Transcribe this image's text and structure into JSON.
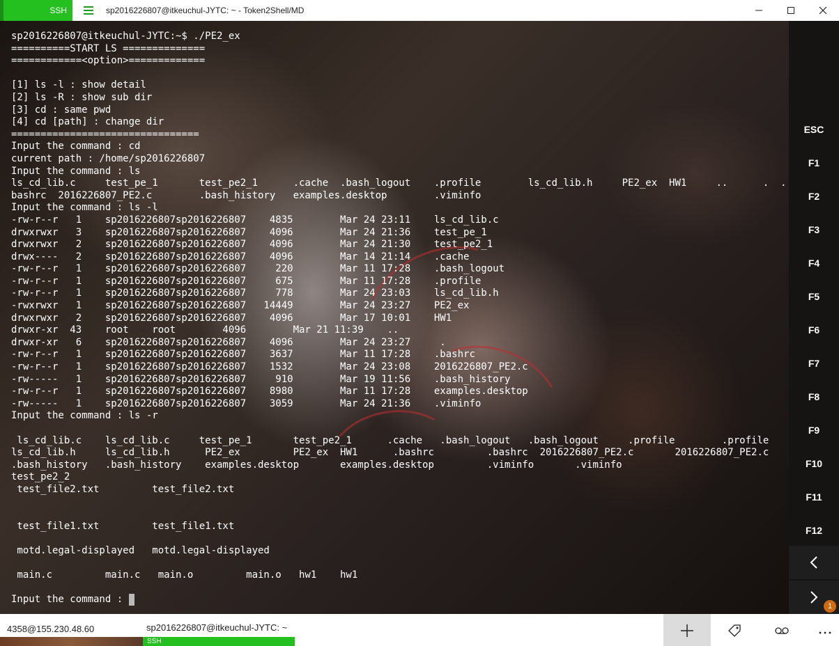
{
  "titlebar": {
    "app_badge": "SSH",
    "title": "sp2016226807@itkeuchul-JYTC: ~ - Token2Shell/MD"
  },
  "terminal": {
    "lines": [
      "sp2016226807@itkeuchul-JYTC:~$ ./PE2_ex",
      "==========START LS ==============",
      "============<option>=============",
      "",
      "[1] ls -l : show detail",
      "[2] ls -R : show sub dir",
      "[3] cd : same pwd",
      "[4] cd [path] : change dir",
      "================================",
      "Input the command : cd",
      "current path : /home/sp2016226807",
      "Input the command : ls",
      "ls_cd_lib.c     test_pe_1       test_pe2_1      .cache  .bash_logout    .profile        ls_cd_lib.h     PE2_ex  HW1     ..      .  .",
      "bashrc  2016226807_PE2.c        .bash_history   examples.desktop        .viminfo",
      "Input the command : ls -l",
      "-rw-r--r   1    sp2016226807sp2016226807    4835        Mar 24 23:11    ls_cd_lib.c",
      "drwxrwxr   3    sp2016226807sp2016226807    4096        Mar 24 21:36    test_pe_1",
      "drwxrwxr   2    sp2016226807sp2016226807    4096        Mar 24 21:30    test_pe2_1",
      "drwx----   2    sp2016226807sp2016226807    4096        Mar 14 21:14    .cache",
      "-rw-r--r   1    sp2016226807sp2016226807     220        Mar 11 17:28    .bash_logout",
      "-rw-r--r   1    sp2016226807sp2016226807     675        Mar 11 17:28    .profile",
      "-rw-r--r   1    sp2016226807sp2016226807     778        Mar 24 23:03    ls_cd_lib.h",
      "-rwxrwxr   1    sp2016226807sp2016226807   14449        Mar 24 23:27    PE2_ex",
      "drwxrwxr   2    sp2016226807sp2016226807    4096        Mar 17 10:01    HW1",
      "drwxr-xr  43    root    root        4096        Mar 21 11:39    ..",
      "drwxr-xr   6    sp2016226807sp2016226807    4096        Mar 24 23:27     .",
      "-rw-r--r   1    sp2016226807sp2016226807    3637        Mar 11 17:28    .bashrc",
      "-rw-r--r   1    sp2016226807sp2016226807    1532        Mar 24 23:08    2016226807_PE2.c",
      "-rw-----   1    sp2016226807sp2016226807     910        Mar 19 11:56    .bash_history",
      "-rw-r--r   1    sp2016226807sp2016226807    8980        Mar 11 17:28    examples.desktop",
      "-rw-----   1    sp2016226807sp2016226807    3059        Mar 24 21:36    .viminfo",
      "Input the command : ls -r",
      "",
      " ls_cd_lib.c    ls_cd_lib.c     test_pe_1       test_pe2_1      .cache   .bash_logout   .bash_logout     .profile        .profile",
      "ls_cd_lib.h     ls_cd_lib.h      PE2_ex         PE2_ex  HW1      .bashrc         .bashrc  2016226807_PE2.c       2016226807_PE2.c",
      ".bash_history   .bash_history    examples.desktop       examples.desktop         .viminfo       .viminfo",
      "test_pe2_2",
      " test_file2.txt         test_file2.txt",
      "",
      "",
      " test_file1.txt         test_file1.txt",
      "",
      " motd.legal-displayed   motd.legal-displayed",
      "",
      " main.c         main.c   main.o         main.o   hw1    hw1",
      ""
    ],
    "prompt": "Input the command : "
  },
  "function_keys": [
    "ESC",
    "F1",
    "F2",
    "F3",
    "F4",
    "F5",
    "F6",
    "F7",
    "F8",
    "F9",
    "F10",
    "F11",
    "F12"
  ],
  "nav": {
    "prev_icon": "chevron-left-icon",
    "next_icon": "chevron-right-icon",
    "notification_count": "1"
  },
  "bottombar": {
    "tabs": [
      {
        "label": "4358@155.230.48.60"
      },
      {
        "label": "sp2016226807@itkeuchul-JYTC: ~",
        "badge": "SSH"
      }
    ],
    "buttons": [
      "plus-icon",
      "tag-icon",
      "voicemail-icon",
      "more-icon"
    ]
  },
  "colors": {
    "accent_green": "#23c01f",
    "terminal_text": "#ffffff",
    "notification": "#d06a10"
  }
}
